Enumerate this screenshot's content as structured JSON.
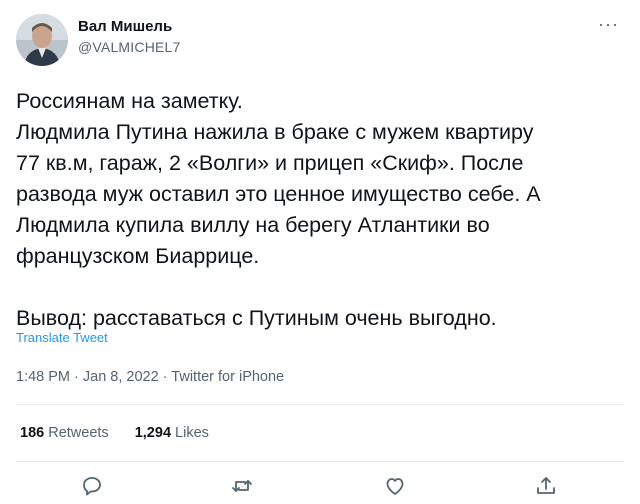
{
  "user": {
    "display_name": "Вал Мишель",
    "handle": "@VALMICHEL7"
  },
  "tweet": {
    "lines": [
      "Россиянам на заметку.",
      "Людмила Путина нажила в браке с мужем квартиру",
      "77 кв.м, гараж, 2 «Волги» и прицеп «Скиф». После",
      "развода муж оставил это ценное имущество себе. А",
      "Людмила купила виллу на берегу Атлантики во",
      "французском Биаррице.",
      "",
      "Вывод: расставаться с Путиным очень выгодно."
    ],
    "translate_label": "Translate Tweet",
    "timestamp": "1:48 PM · Jan 8, 2022 · Twitter for iPhone"
  },
  "stats": {
    "retweets_count": "186",
    "retweets_label": "Retweets",
    "likes_count": "1,294",
    "likes_label": "Likes"
  },
  "icons": {
    "more": "more-horizontal-icon",
    "reply": "reply-icon",
    "retweet": "retweet-icon",
    "like": "heart-icon",
    "share": "share-icon"
  },
  "colors": {
    "text": "#0f1419",
    "secondary": "#536471",
    "link": "#1d9bf0",
    "divider": "#e7e9ea"
  }
}
